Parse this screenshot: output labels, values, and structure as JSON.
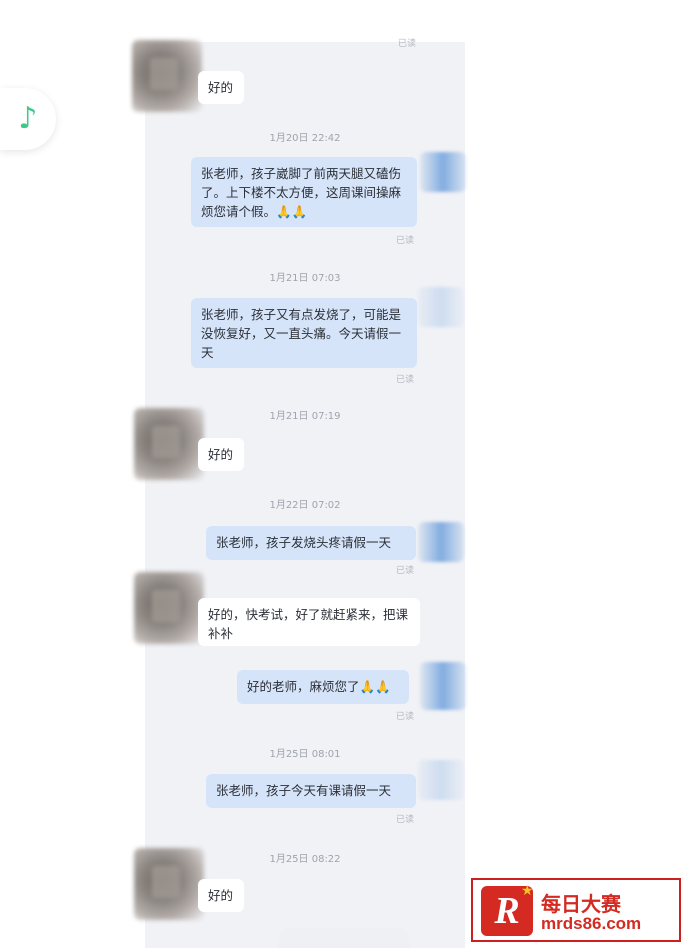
{
  "side_tab": {
    "icon": "music-note-icon",
    "glyph": "♪",
    "accent": "#3ec98a"
  },
  "read_status": "已读",
  "messages": [
    {
      "type": "in",
      "text": "好的"
    },
    {
      "type": "time",
      "text": "1月20日 22:42"
    },
    {
      "type": "out",
      "text": "张老师，孩子崴脚了前两天腿又磕伤了。上下楼不太方便，这周课间操麻烦您请个假。🙏🙏"
    },
    {
      "type": "time",
      "text": "1月21日 07:03"
    },
    {
      "type": "out",
      "text": "张老师，孩子又有点发烧了，可能是没恢复好，又一直头痛。今天请假一天"
    },
    {
      "type": "time",
      "text": "1月21日 07:19"
    },
    {
      "type": "in",
      "text": "好的"
    },
    {
      "type": "time",
      "text": "1月22日 07:02"
    },
    {
      "type": "out",
      "text": "张老师，孩子发烧头疼请假一天"
    },
    {
      "type": "in",
      "text": "好的，快考试，好了就赶紧来，把课补补"
    },
    {
      "type": "out",
      "text": "好的老师，麻烦您了🙏🙏"
    },
    {
      "type": "time",
      "text": "1月25日 08:01"
    },
    {
      "type": "out",
      "text": "张老师，孩子今天有课请假一天"
    },
    {
      "type": "time",
      "text": "1月25日 08:22"
    },
    {
      "type": "in",
      "text": "好的"
    }
  ],
  "watermark": {
    "logo_letter": "R",
    "title": "每日大赛",
    "url": "mrds86.com"
  }
}
